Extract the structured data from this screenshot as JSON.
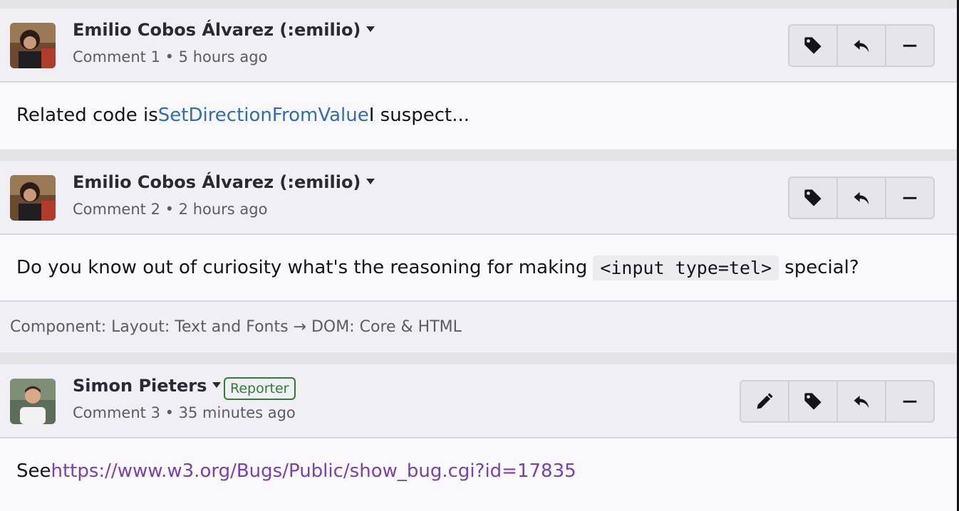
{
  "comments": [
    {
      "author": "Emilio Cobos Álvarez (:emilio)",
      "meta": "Comment 1 • 5 hours ago",
      "body_text": "Related code is ",
      "body_link": "SetDirectionFromValue",
      "body_suffix": " I suspect..."
    },
    {
      "author": "Emilio Cobos Álvarez (:emilio)",
      "meta": "Comment 2 • 2 hours ago",
      "body_text": "Do you know out of curiosity what's the reasoning for making",
      "body_code": "<input type=tel>",
      "body_suffix": "special?",
      "component_change": "Component: Layout: Text and Fonts → DOM: Core & HTML"
    },
    {
      "author": "Simon Pieters",
      "badge": "Reporter",
      "meta": "Comment 3 • 35 minutes ago",
      "body_text": "See ",
      "body_link": "https://www.w3.org/Bugs/Public/show_bug.cgi?id=17835"
    }
  ],
  "icons": {
    "tag": "tag-icon",
    "reply": "reply-icon",
    "collapse": "minus-icon",
    "edit": "pencil-icon"
  }
}
